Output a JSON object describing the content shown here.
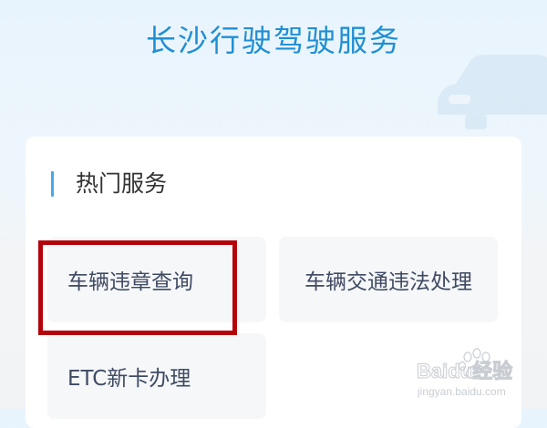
{
  "header": {
    "title": "长沙行驶驾驶服务"
  },
  "section": {
    "title": "热门服务"
  },
  "services": [
    {
      "label": "车辆违章查询"
    },
    {
      "label": "车辆交通违法处理"
    },
    {
      "label": "ETC新卡办理"
    }
  ],
  "watermark": {
    "brand": "Baidu经验",
    "url": "jingyan.baidu.com"
  },
  "colors": {
    "accent": "#1f8fd4",
    "section_bar": "#4aa8ea",
    "highlight": "#b4030b"
  }
}
